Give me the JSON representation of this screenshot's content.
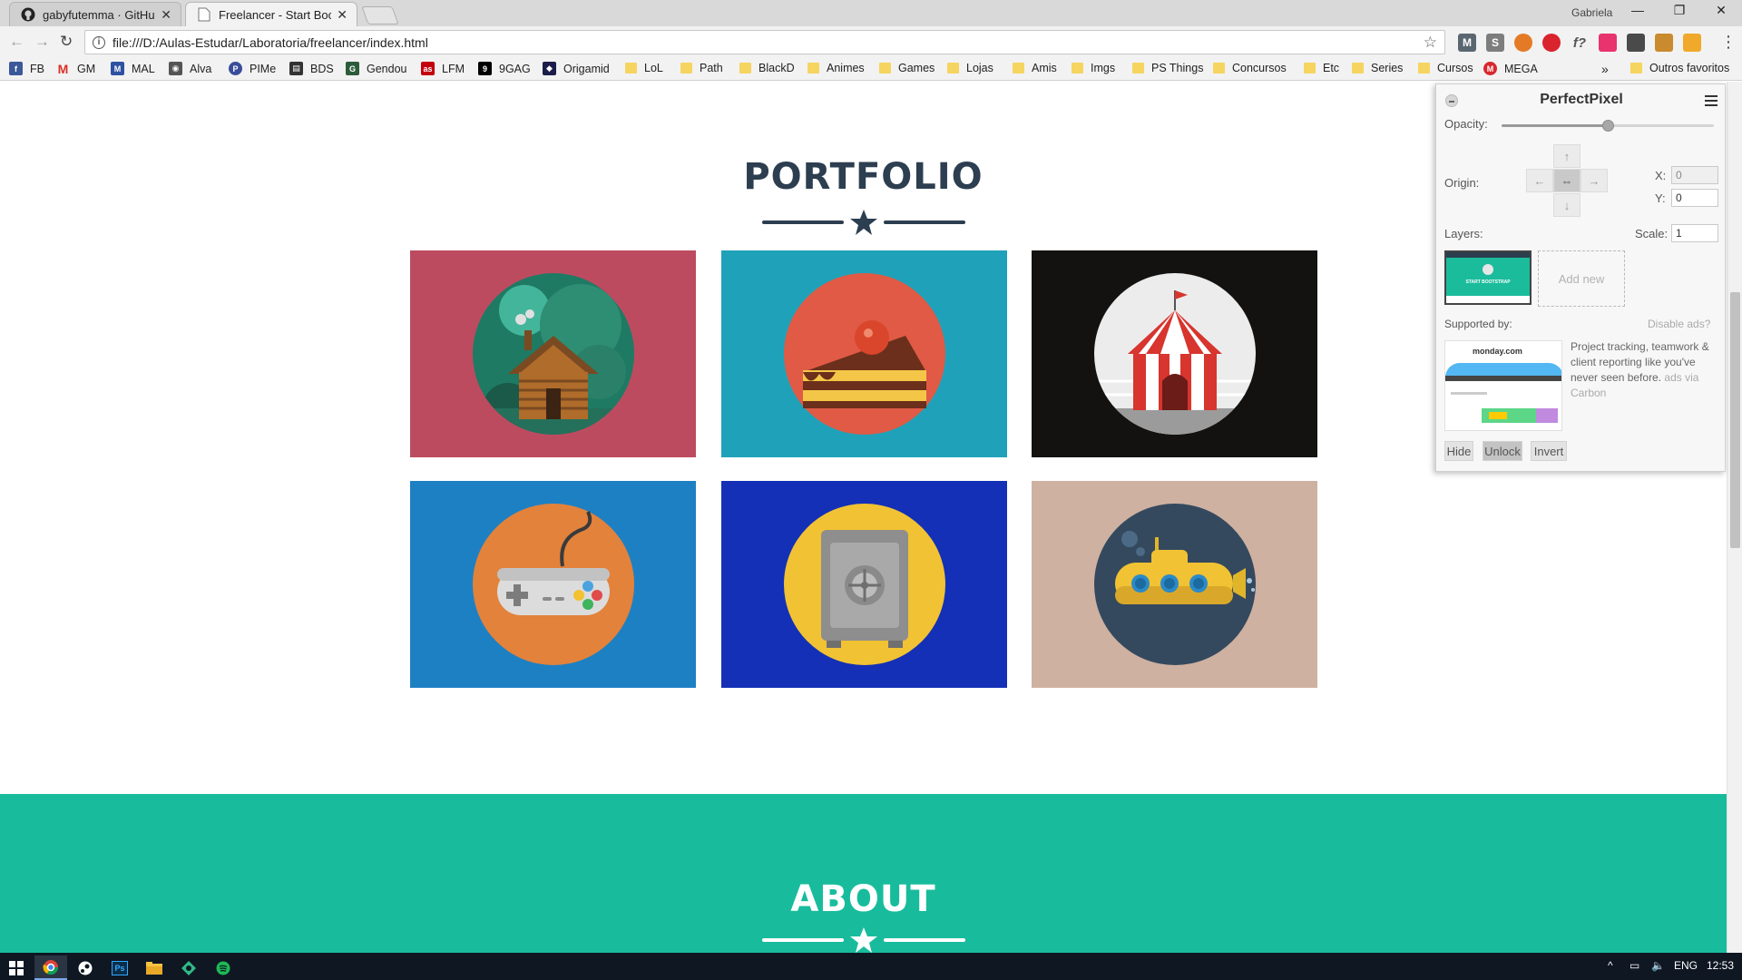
{
  "browser": {
    "tabs": [
      {
        "title": "gabyfutemma · GitHub",
        "active": false
      },
      {
        "title": "Freelancer - Start Bootstr",
        "active": true
      }
    ],
    "profile_name": "Gabriela",
    "url": "file:///D:/Aulas-Estudar/Laboratoria/freelancer/index.html",
    "extensions": [
      "M",
      "S",
      "f?"
    ],
    "bookmarks": [
      {
        "label": "FB",
        "icon": "facebook-icon",
        "color": "#3b5998"
      },
      {
        "label": "GM",
        "icon": "gmail-icon",
        "color": "#d93025"
      },
      {
        "label": "MAL",
        "icon": "mal-icon",
        "color": "#2e51a2"
      },
      {
        "label": "Alva",
        "icon": "gamepad-icon",
        "color": "#555555"
      },
      {
        "label": "PIMe",
        "icon": "pin-icon",
        "color": "#3a4c9b"
      },
      {
        "label": "BDS",
        "icon": "film-icon",
        "color": "#333333"
      },
      {
        "label": "Gendou",
        "icon": "gendou-icon",
        "color": "#2d5c3a"
      },
      {
        "label": "LFM",
        "icon": "lastfm-icon",
        "color": "#c3000d"
      },
      {
        "label": "9GAG",
        "icon": "9gag-icon",
        "color": "#000000"
      },
      {
        "label": "Origamid",
        "icon": "origamid-icon",
        "color": "#1c1c4a"
      },
      {
        "label": "LoL",
        "icon": "folder-icon",
        "color": "#f6d460"
      },
      {
        "label": "Path",
        "icon": "folder-icon",
        "color": "#f6d460"
      },
      {
        "label": "BlackD",
        "icon": "folder-icon",
        "color": "#f6d460"
      },
      {
        "label": "Animes",
        "icon": "folder-icon",
        "color": "#f6d460"
      },
      {
        "label": "Games",
        "icon": "folder-icon",
        "color": "#f6d460"
      },
      {
        "label": "Lojas",
        "icon": "folder-icon",
        "color": "#f6d460"
      },
      {
        "label": "Amis",
        "icon": "folder-icon",
        "color": "#f6d460"
      },
      {
        "label": "Imgs",
        "icon": "folder-icon",
        "color": "#f6d460"
      },
      {
        "label": "PS Things",
        "icon": "folder-icon",
        "color": "#f6d460"
      },
      {
        "label": "Concursos",
        "icon": "folder-icon",
        "color": "#f6d460"
      },
      {
        "label": "Etc",
        "icon": "folder-icon",
        "color": "#f6d460"
      },
      {
        "label": "Series",
        "icon": "folder-icon",
        "color": "#f6d460"
      },
      {
        "label": "Cursos",
        "icon": "folder-icon",
        "color": "#f6d460"
      },
      {
        "label": "MEGA",
        "icon": "mega-icon",
        "color": "#d9272e"
      }
    ],
    "bookmarks_overflow": "»",
    "other_bookmarks": "Outros favoritos"
  },
  "page": {
    "portfolio_title": "PORTFOLIO",
    "about_title": "ABOUT",
    "colors": {
      "primary": "#2c3e50",
      "accent": "#18bc9c"
    },
    "portfolio_items": [
      {
        "name": "cabin",
        "bg": "#bd4b60",
        "icon": "cabin-icon"
      },
      {
        "name": "cake",
        "bg": "#1fa2b9",
        "icon": "cake-icon"
      },
      {
        "name": "circus",
        "bg": "#141211",
        "icon": "circus-tent-icon"
      },
      {
        "name": "game",
        "bg": "#1d80c3",
        "icon": "game-controller-icon"
      },
      {
        "name": "safe",
        "bg": "#1330b6",
        "icon": "safe-icon"
      },
      {
        "name": "submarine",
        "bg": "#ceb1a1",
        "icon": "submarine-icon"
      }
    ]
  },
  "perfectpixel": {
    "title": "PerfectPixel",
    "opacity_label": "Opacity:",
    "opacity_value": 0.5,
    "origin_label": "Origin:",
    "x_label": "X:",
    "x_value": "0",
    "y_label": "Y:",
    "y_value": "0",
    "layers_label": "Layers:",
    "scale_label": "Scale:",
    "scale_value": "1",
    "layer_thumb_text": "START BOOTSTRAP",
    "add_new": "Add new",
    "supported_by": "Supported by:",
    "disable_ads": "Disable ads?",
    "ad_text": "Project tracking, teamwork & client reporting like you've never seen before.",
    "ad_via": "ads via Carbon",
    "ad_brand": "monday.com",
    "hide_button": "Hide",
    "unlock_button": "Unlock",
    "invert_button": "Invert"
  },
  "taskbar": {
    "language": "ENG",
    "time": "12:53"
  }
}
